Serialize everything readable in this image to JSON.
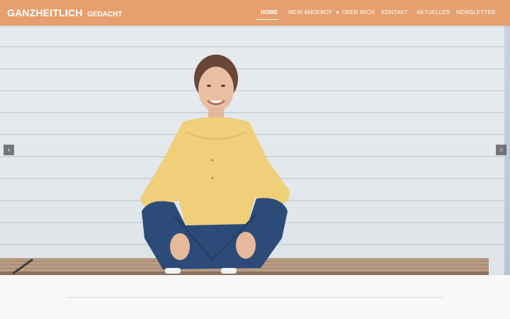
{
  "header": {
    "brand_main": "GANZHEITLICH",
    "brand_sub": "GEDACHT",
    "nav": [
      {
        "label": "HOME"
      },
      {
        "label": "MEIN ANGEBOT"
      },
      {
        "label": "ÜBER MICH"
      },
      {
        "label": "KONTAKT"
      },
      {
        "label": "AKTUELLES"
      },
      {
        "label": "NEWSLETTER"
      }
    ],
    "dropdown_caret": "▼"
  },
  "hero": {
    "prev_icon": "‹",
    "next_icon": "›"
  },
  "colors": {
    "navbar": "#e69f6e",
    "nav_text": "#ffffff",
    "page_bg": "#f8f8f8"
  }
}
